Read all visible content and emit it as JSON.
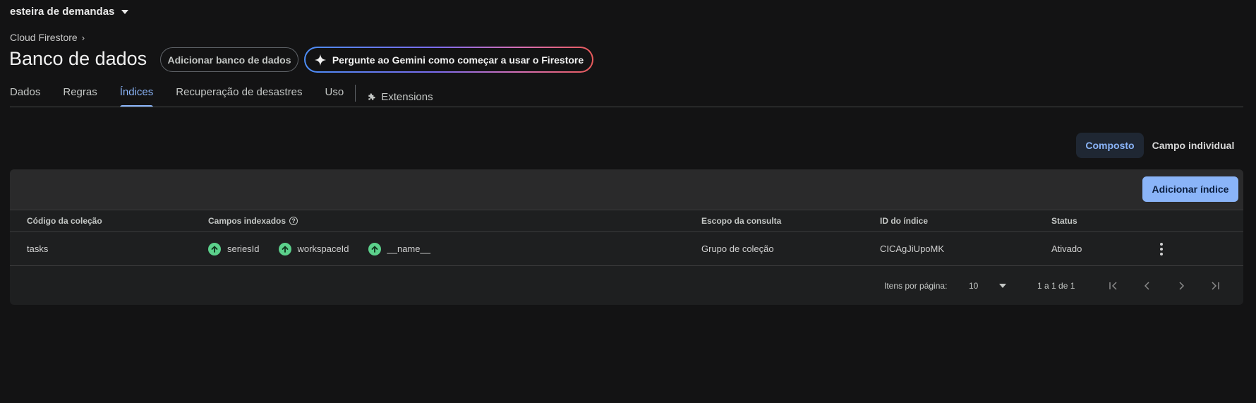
{
  "project": {
    "name": "esteira de demandas"
  },
  "breadcrumb": {
    "label": "Cloud Firestore"
  },
  "page": {
    "title": "Banco de dados"
  },
  "buttons": {
    "add_database": "Adicionar banco de dados",
    "gemini": "Pergunte ao Gemini como começar a usar o Firestore"
  },
  "tabs": [
    {
      "label": "Dados",
      "active": false
    },
    {
      "label": "Regras",
      "active": false
    },
    {
      "label": "Índices",
      "active": true
    },
    {
      "label": "Recuperação de desastres",
      "active": false
    },
    {
      "label": "Uso",
      "active": false
    },
    {
      "label": "Extensions",
      "icon": "puzzle-icon"
    }
  ],
  "segments": {
    "composite": "Composto",
    "single_field": "Campo individual",
    "selected": "Composto"
  },
  "table": {
    "add_index_label": "Adicionar índice",
    "headers": {
      "collection": "Código da coleção",
      "fields": "Campos indexados",
      "scope": "Escopo da consulta",
      "index_id": "ID do índice",
      "status": "Status"
    },
    "rows": [
      {
        "collection": "tasks",
        "fields": [
          {
            "name": "seriesId",
            "order": "ascending",
            "icon": "arrow-up-icon"
          },
          {
            "name": "workspaceId",
            "order": "ascending",
            "icon": "arrow-up-icon"
          },
          {
            "name": "__name__",
            "order": "ascending",
            "icon": "arrow-up-icon"
          }
        ],
        "scope": "Grupo de coleção",
        "index_id": "CICAgJiUpoMK",
        "status": "Ativado"
      }
    ]
  },
  "pagination": {
    "items_per_page_label": "Itens por página:",
    "items_per_page_value": "10",
    "range": "1 a 1 de 1"
  },
  "colors": {
    "accent": "#8ab4f8",
    "ascending": "#5bd08b",
    "background": "#131314"
  }
}
